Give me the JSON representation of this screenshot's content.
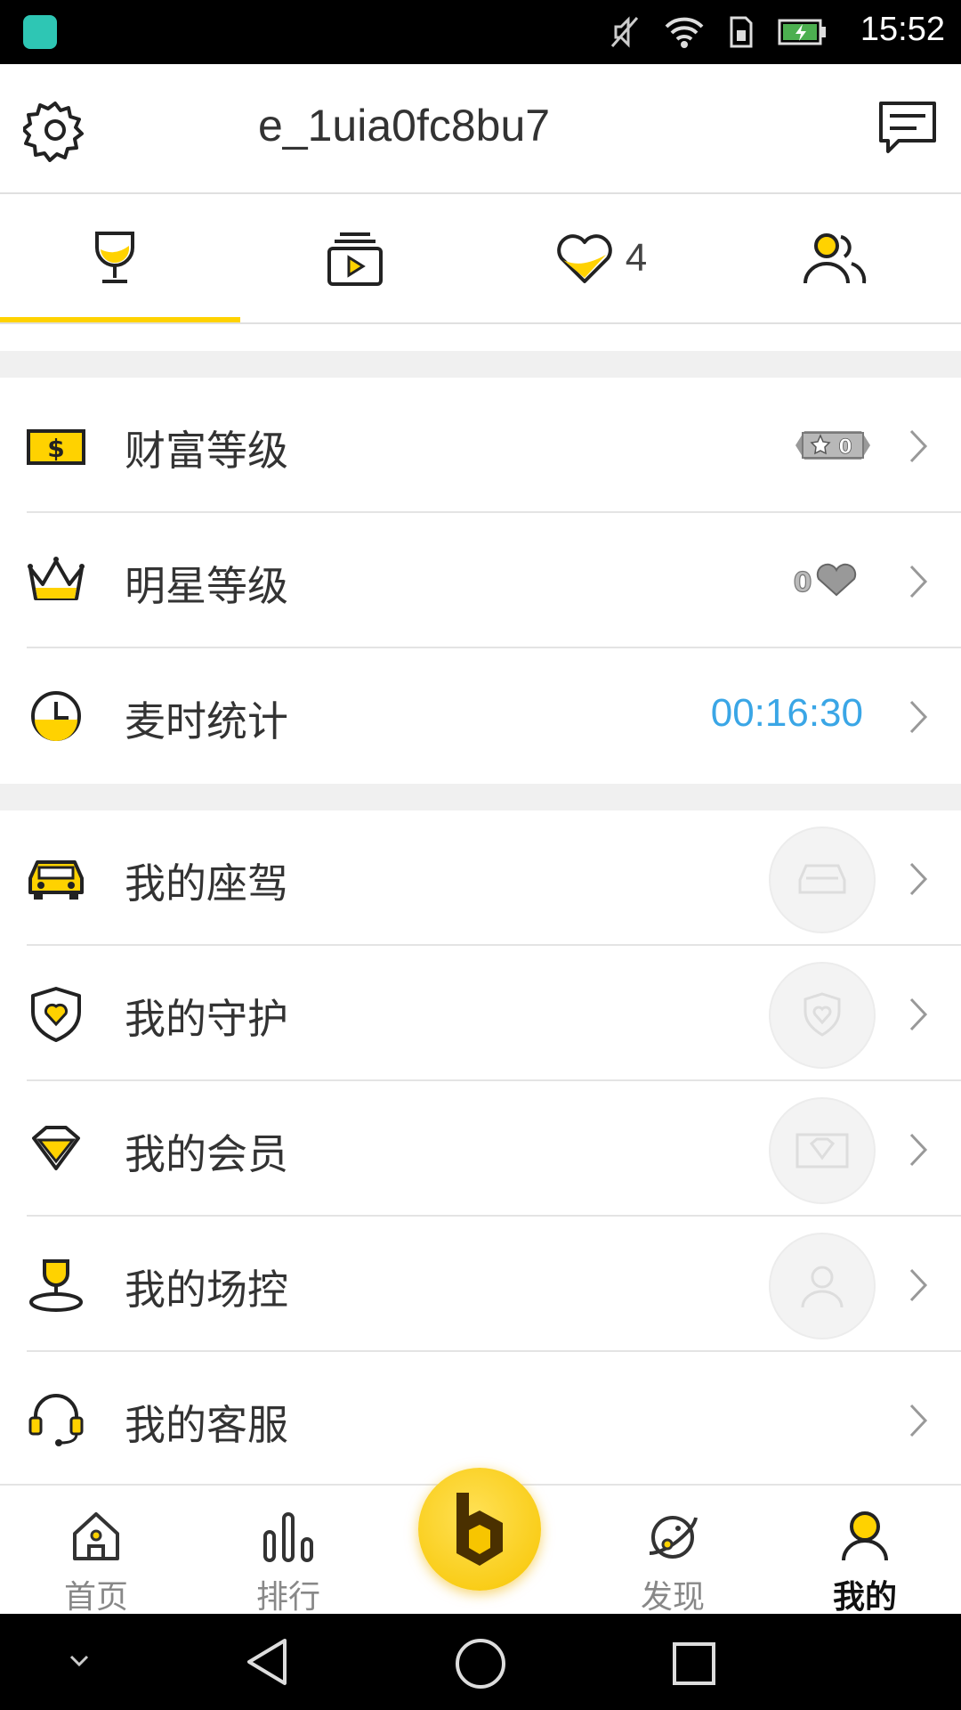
{
  "status_bar": {
    "time": "15:52",
    "icons": [
      "android-icon",
      "mute-icon",
      "wifi-icon",
      "sim-icon",
      "battery-charging-icon"
    ]
  },
  "header": {
    "username": "e_1uia0fc8bu7",
    "left_icon": "gear-icon",
    "right_icon": "message-icon"
  },
  "tabs": [
    {
      "icon": "trophy-icon",
      "count": ""
    },
    {
      "icon": "video-stack-icon",
      "count": ""
    },
    {
      "icon": "heart-icon",
      "count": "4"
    },
    {
      "icon": "users-icon",
      "count": ""
    }
  ],
  "list": {
    "wealth": {
      "label": "财富等级",
      "badge": "0",
      "icon": "money-icon"
    },
    "star": {
      "label": "明星等级",
      "badge": "0",
      "icon": "crown-icon"
    },
    "mic_time": {
      "label": "麦时统计",
      "value": "00:16:30",
      "icon": "clock-icon"
    },
    "car": {
      "label": "我的座驾",
      "icon": "car-icon"
    },
    "guard": {
      "label": "我的守护",
      "icon": "shield-heart-icon"
    },
    "vip": {
      "label": "我的会员",
      "icon": "diamond-icon"
    },
    "control": {
      "label": "我的场控",
      "icon": "admin-user-icon"
    },
    "service": {
      "label": "我的客服",
      "icon": "headset-icon"
    }
  },
  "bottom_nav": [
    {
      "label": "首页",
      "icon": "home-icon"
    },
    {
      "label": "排行",
      "icon": "ranking-icon"
    },
    {
      "label": "",
      "icon": "b-logo-icon"
    },
    {
      "label": "发现",
      "icon": "planet-icon"
    },
    {
      "label": "我的",
      "icon": "me-icon"
    }
  ],
  "colors": {
    "accent": "#ffd200",
    "value_blue": "#3aa6e6",
    "text": "#333333"
  }
}
